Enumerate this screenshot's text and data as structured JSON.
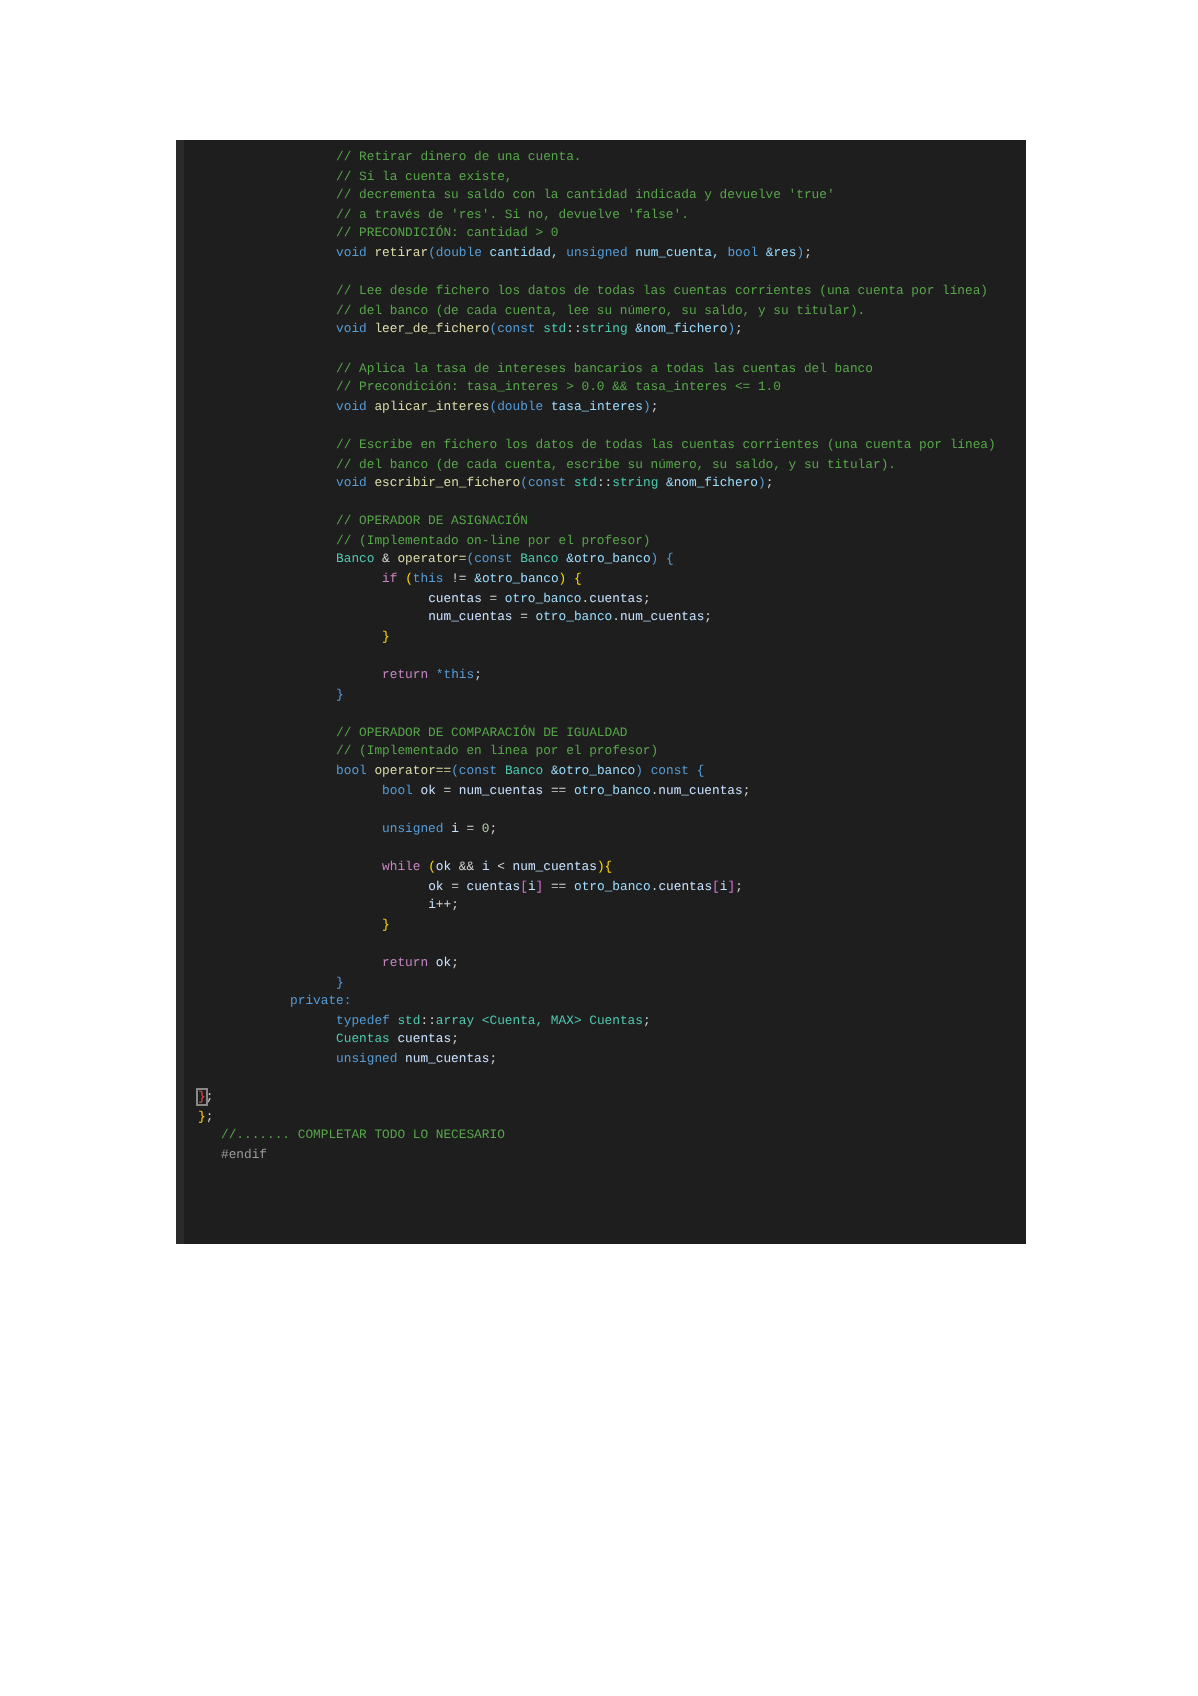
{
  "editor": {
    "lines": [
      {
        "tokens": [
          {
            "text": "\t\t\t// Retirar dinero de una cuenta.",
            "kind": "comment"
          }
        ]
      },
      {
        "tokens": [
          {
            "text": "\t\t\t// Si la cuenta existe,",
            "kind": "comment"
          }
        ]
      },
      {
        "tokens": [
          {
            "text": "\t\t\t// decrementa su saldo con la cantidad indicada y devuelve 'true'",
            "kind": "comment"
          }
        ]
      },
      {
        "tokens": [
          {
            "text": "\t\t\t// a través de 'res'. Si no, devuelve 'false'.",
            "kind": "comment"
          }
        ]
      },
      {
        "tokens": [
          {
            "text": "\t\t\t// PRECONDICIÓN: cantidad > 0",
            "kind": "comment"
          }
        ]
      },
      {
        "tokens": [
          {
            "text": "\t\t\tvoid ",
            "kind": "keyword"
          },
          {
            "text": "retirar",
            "kind": "function"
          },
          {
            "text": "(",
            "kind": "brace"
          },
          {
            "text": "double ",
            "kind": "keyword"
          },
          {
            "text": "cantidad, ",
            "kind": "param"
          },
          {
            "text": "unsigned ",
            "kind": "keyword"
          },
          {
            "text": "num_cuenta, ",
            "kind": "param"
          },
          {
            "text": "bool ",
            "kind": "keyword"
          },
          {
            "text": "&res",
            "kind": "param"
          },
          {
            "text": ")",
            "kind": "brace"
          },
          {
            "text": ";",
            "kind": "plain"
          }
        ]
      },
      {
        "kind": "blank"
      },
      {
        "tokens": [
          {
            "text": "\t\t\t// Lee desde fichero los datos de todas las cuentas corrientes (una cuenta por línea)",
            "kind": "comment"
          }
        ]
      },
      {
        "tokens": [
          {
            "text": "\t\t\t// del banco (de cada cuenta, lee su número, su saldo, y su titular).",
            "kind": "comment"
          }
        ]
      },
      {
        "tokens": [
          {
            "text": "\t\t\tvoid ",
            "kind": "keyword"
          },
          {
            "text": "leer_de_fichero",
            "kind": "function"
          },
          {
            "text": "(",
            "kind": "brace"
          },
          {
            "text": "const ",
            "kind": "keyword"
          },
          {
            "text": "std",
            "kind": "type"
          },
          {
            "text": "::",
            "kind": "plain"
          },
          {
            "text": "string ",
            "kind": "type"
          },
          {
            "text": "&nom_fichero",
            "kind": "param"
          },
          {
            "text": ")",
            "kind": "brace"
          },
          {
            "text": ";",
            "kind": "plain"
          }
        ]
      },
      {
        "kind": "blank"
      },
      {
        "tokens": [
          {
            "text": "\t\t\t// Aplica la tasa de intereses bancarios a todas las cuentas del banco",
            "kind": "comment"
          }
        ]
      },
      {
        "tokens": [
          {
            "text": "\t\t\t// Precondición: tasa_interes > 0.0 && tasa_interes <= 1.0",
            "kind": "comment"
          }
        ]
      },
      {
        "tokens": [
          {
            "text": "\t\t\tvoid ",
            "kind": "keyword"
          },
          {
            "text": "aplicar_interes",
            "kind": "function"
          },
          {
            "text": "(",
            "kind": "brace"
          },
          {
            "text": "double ",
            "kind": "keyword"
          },
          {
            "text": "tasa_interes",
            "kind": "param"
          },
          {
            "text": ")",
            "kind": "brace"
          },
          {
            "text": ";",
            "kind": "plain"
          }
        ]
      },
      {
        "kind": "blank"
      },
      {
        "tokens": [
          {
            "text": "\t\t\t// Escribe en fichero los datos de todas las cuentas corrientes (una cuenta por línea)",
            "kind": "comment"
          }
        ]
      },
      {
        "tokens": [
          {
            "text": "\t\t\t// del banco (de cada cuenta, escribe su número, su saldo, y su titular).",
            "kind": "comment"
          }
        ]
      },
      {
        "tokens": [
          {
            "text": "\t\t\tvoid ",
            "kind": "keyword"
          },
          {
            "text": "escribir_en_fichero",
            "kind": "function"
          },
          {
            "text": "(",
            "kind": "brace"
          },
          {
            "text": "const ",
            "kind": "keyword"
          },
          {
            "text": "std",
            "kind": "type"
          },
          {
            "text": "::",
            "kind": "plain"
          },
          {
            "text": "string ",
            "kind": "type"
          },
          {
            "text": "&nom_fichero",
            "kind": "param"
          },
          {
            "text": ")",
            "kind": "brace"
          },
          {
            "text": ";",
            "kind": "plain"
          }
        ]
      },
      {
        "kind": "blank"
      },
      {
        "tokens": [
          {
            "text": "\t\t\t// OPERADOR DE ASIGNACIÓN",
            "kind": "comment"
          }
        ]
      },
      {
        "tokens": [
          {
            "text": "\t\t\t// (Implementado on-line por el profesor)",
            "kind": "comment"
          }
        ]
      },
      {
        "tokens": [
          {
            "text": "\t\t\tBanco ",
            "kind": "type"
          },
          {
            "text": "& ",
            "kind": "plain"
          },
          {
            "text": "operator=",
            "kind": "function"
          },
          {
            "text": "(",
            "kind": "brace"
          },
          {
            "text": "const ",
            "kind": "keyword"
          },
          {
            "text": "Banco ",
            "kind": "type"
          },
          {
            "text": "&otro_banco",
            "kind": "param"
          },
          {
            "text": ") {",
            "kind": "brace"
          }
        ]
      },
      {
        "tokens": [
          {
            "text": "\t\t\t\tif ",
            "kind": "control"
          },
          {
            "text": "(",
            "kind": "brace2"
          },
          {
            "text": "this ",
            "kind": "keyword"
          },
          {
            "text": "!= ",
            "kind": "plain"
          },
          {
            "text": "&otro_banco",
            "kind": "param"
          },
          {
            "text": ") {",
            "kind": "brace2"
          }
        ]
      },
      {
        "tokens": [
          {
            "text": "\t\t\t\t\tcuentas ",
            "kind": "var"
          },
          {
            "text": "= ",
            "kind": "plain"
          },
          {
            "text": "otro_banco",
            "kind": "param"
          },
          {
            "text": ".",
            "kind": "plain"
          },
          {
            "text": "cuentas",
            "kind": "var"
          },
          {
            "text": ";",
            "kind": "plain"
          }
        ]
      },
      {
        "tokens": [
          {
            "text": "\t\t\t\t\tnum_cuentas ",
            "kind": "var"
          },
          {
            "text": "= ",
            "kind": "plain"
          },
          {
            "text": "otro_banco",
            "kind": "param"
          },
          {
            "text": ".",
            "kind": "plain"
          },
          {
            "text": "num_cuentas",
            "kind": "var"
          },
          {
            "text": ";",
            "kind": "plain"
          }
        ]
      },
      {
        "tokens": [
          {
            "text": "\t\t\t\t}",
            "kind": "brace2"
          }
        ]
      },
      {
        "kind": "blank"
      },
      {
        "tokens": [
          {
            "text": "\t\t\t\treturn ",
            "kind": "control"
          },
          {
            "text": "*this",
            "kind": "keyword"
          },
          {
            "text": ";",
            "kind": "plain"
          }
        ]
      },
      {
        "tokens": [
          {
            "text": "\t\t\t}",
            "kind": "brace"
          }
        ]
      },
      {
        "kind": "blank"
      },
      {
        "tokens": [
          {
            "text": "\t\t\t// OPERADOR DE COMPARACIÓN DE IGUALDAD",
            "kind": "comment"
          }
        ]
      },
      {
        "tokens": [
          {
            "text": "\t\t\t// (Implementado en línea por el profesor)",
            "kind": "comment"
          }
        ]
      },
      {
        "tokens": [
          {
            "text": "\t\t\tbool ",
            "kind": "keyword"
          },
          {
            "text": "operator==",
            "kind": "function"
          },
          {
            "text": "(",
            "kind": "brace"
          },
          {
            "text": "const ",
            "kind": "keyword"
          },
          {
            "text": "Banco ",
            "kind": "type"
          },
          {
            "text": "&otro_banco",
            "kind": "param"
          },
          {
            "text": ") ",
            "kind": "brace"
          },
          {
            "text": "const ",
            "kind": "keyword"
          },
          {
            "text": "{",
            "kind": "brace"
          }
        ]
      },
      {
        "tokens": [
          {
            "text": "\t\t\t\tbool ",
            "kind": "keyword"
          },
          {
            "text": "ok ",
            "kind": "var"
          },
          {
            "text": "= ",
            "kind": "plain"
          },
          {
            "text": "num_cuentas ",
            "kind": "var"
          },
          {
            "text": "== ",
            "kind": "plain"
          },
          {
            "text": "otro_banco",
            "kind": "param"
          },
          {
            "text": ".",
            "kind": "plain"
          },
          {
            "text": "num_cuentas",
            "kind": "var"
          },
          {
            "text": ";",
            "kind": "plain"
          }
        ]
      },
      {
        "kind": "blank"
      },
      {
        "tokens": [
          {
            "text": "\t\t\t\tunsigned ",
            "kind": "keyword"
          },
          {
            "text": "i ",
            "kind": "var"
          },
          {
            "text": "= ",
            "kind": "plain"
          },
          {
            "text": "0",
            "kind": "number"
          },
          {
            "text": ";",
            "kind": "plain"
          }
        ]
      },
      {
        "kind": "blank"
      },
      {
        "tokens": [
          {
            "text": "\t\t\t\twhile ",
            "kind": "control"
          },
          {
            "text": "(",
            "kind": "brace2"
          },
          {
            "text": "ok ",
            "kind": "var"
          },
          {
            "text": "&& ",
            "kind": "plain"
          },
          {
            "text": "i ",
            "kind": "var"
          },
          {
            "text": "< ",
            "kind": "plain"
          },
          {
            "text": "num_cuentas",
            "kind": "var"
          },
          {
            "text": "){",
            "kind": "brace2"
          }
        ]
      },
      {
        "tokens": [
          {
            "text": "\t\t\t\t\tok ",
            "kind": "var"
          },
          {
            "text": "= ",
            "kind": "plain"
          },
          {
            "text": "cuentas",
            "kind": "var"
          },
          {
            "text": "[",
            "kind": "brace3"
          },
          {
            "text": "i",
            "kind": "var"
          },
          {
            "text": "] ",
            "kind": "brace3"
          },
          {
            "text": "== ",
            "kind": "plain"
          },
          {
            "text": "otro_banco",
            "kind": "param"
          },
          {
            "text": ".",
            "kind": "plain"
          },
          {
            "text": "cuentas",
            "kind": "var"
          },
          {
            "text": "[",
            "kind": "brace3"
          },
          {
            "text": "i",
            "kind": "var"
          },
          {
            "text": "]",
            "kind": "brace3"
          },
          {
            "text": ";",
            "kind": "plain"
          }
        ]
      },
      {
        "tokens": [
          {
            "text": "\t\t\t\t\ti",
            "kind": "var"
          },
          {
            "text": "++;",
            "kind": "plain"
          }
        ]
      },
      {
        "tokens": [
          {
            "text": "\t\t\t\t}",
            "kind": "brace2"
          }
        ]
      },
      {
        "kind": "blank"
      },
      {
        "tokens": [
          {
            "text": "\t\t\t\treturn ",
            "kind": "control"
          },
          {
            "text": "ok",
            "kind": "var"
          },
          {
            "text": ";",
            "kind": "plain"
          }
        ]
      },
      {
        "tokens": [
          {
            "text": "\t\t\t}",
            "kind": "brace"
          }
        ]
      },
      {
        "tokens": [
          {
            "text": "\t\tprivate:",
            "kind": "keyword"
          }
        ]
      },
      {
        "tokens": [
          {
            "text": "\t\t\ttypedef ",
            "kind": "keyword"
          },
          {
            "text": "std",
            "kind": "type"
          },
          {
            "text": "::",
            "kind": "plain"
          },
          {
            "text": "array ",
            "kind": "type"
          },
          {
            "text": "<Cuenta, MAX> ",
            "kind": "type"
          },
          {
            "text": "Cuentas",
            "kind": "type"
          },
          {
            "text": ";",
            "kind": "plain"
          }
        ]
      },
      {
        "tokens": [
          {
            "text": "\t\t\tCuentas ",
            "kind": "type"
          },
          {
            "text": "cuentas",
            "kind": "var"
          },
          {
            "text": ";",
            "kind": "plain"
          }
        ]
      },
      {
        "tokens": [
          {
            "text": "\t\t\tunsigned ",
            "kind": "keyword"
          },
          {
            "text": "num_cuentas",
            "kind": "var"
          },
          {
            "text": ";",
            "kind": "plain"
          }
        ]
      },
      {
        "kind": "blank"
      },
      {
        "tokens": [
          {
            "text": "}",
            "kind": "error"
          },
          {
            "text": ";",
            "kind": "plain"
          }
        ]
      },
      {
        "tokens": [
          {
            "text": "}",
            "kind": "brace2"
          },
          {
            "text": ";",
            "kind": "plain"
          }
        ]
      },
      {
        "tokens": [
          {
            "text": "   //....... COMPLETAR TODO LO NECESARIO",
            "kind": "comment"
          }
        ]
      },
      {
        "tokens": [
          {
            "text": "   #endif",
            "kind": "preproc"
          }
        ]
      }
    ]
  }
}
